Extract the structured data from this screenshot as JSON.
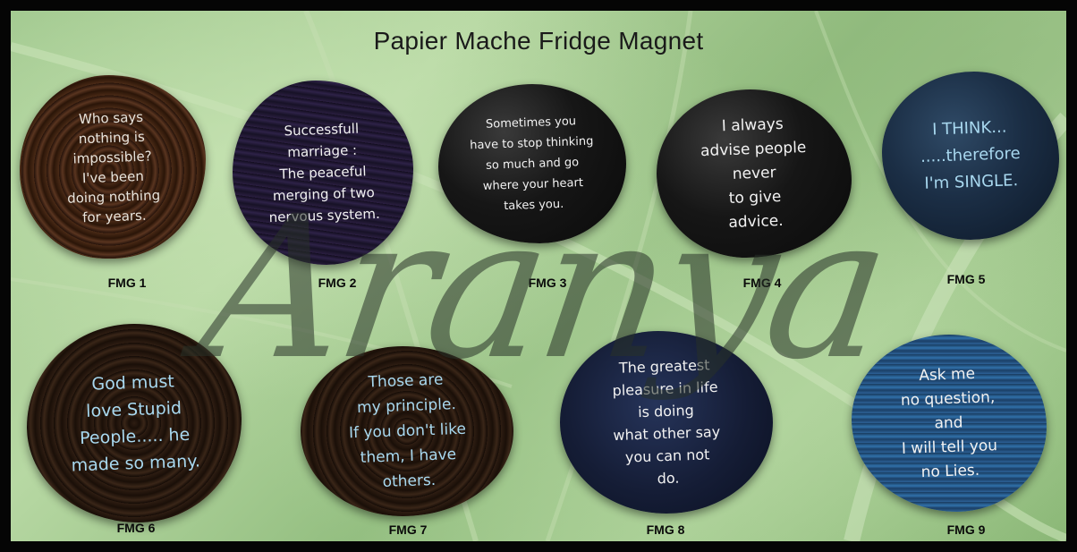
{
  "title": "Papier Mache Fridge Magnet",
  "watermark": "Aranya",
  "magnets": [
    {
      "code": "FMG 1",
      "text": "Who says\nnothing is\nimpossible?\nI've been\ndoing nothing\nfor years."
    },
    {
      "code": "FMG 2",
      "text": "Successfull\nmarriage :\nThe peaceful\nmerging of two\nnervous system."
    },
    {
      "code": "FMG 3",
      "text": "Sometimes you\nhave to stop thinking\nso much and go\nwhere your heart\ntakes you."
    },
    {
      "code": "FMG 4",
      "text": "I always\nadvise people\nnever\nto give\nadvice."
    },
    {
      "code": "FMG 5",
      "text": "I THINK...\n.....therefore\nI'm SINGLE."
    },
    {
      "code": "FMG 6",
      "text": "God must\nlove Stupid\nPeople..... he\nmade so many."
    },
    {
      "code": "FMG 7",
      "text": "Those are\nmy principle.\nIf you don't like\nthem, I have\nothers."
    },
    {
      "code": "FMG 8",
      "text": "The greatest\npleasure in life\nis doing\nwhat other say\nyou can not\ndo."
    },
    {
      "code": "FMG 9",
      "text": "Ask me\nno question,\nand\nI will tell you\nno Lies."
    }
  ],
  "colors": {
    "frame": "#050505",
    "leaf": "#a3cb90",
    "label": "#0a0a0a"
  }
}
